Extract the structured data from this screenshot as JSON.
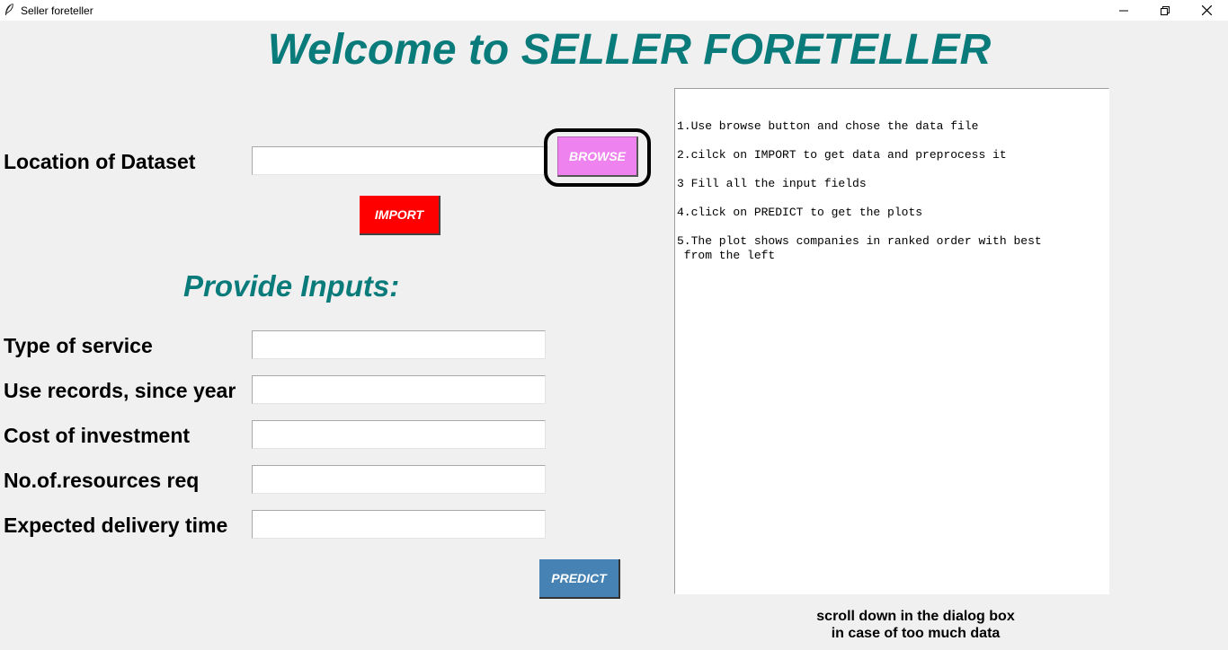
{
  "window": {
    "title": "Seller foreteller",
    "icon": "feather-icon",
    "controls": [
      "minimize-icon",
      "maximize-icon",
      "close-icon"
    ]
  },
  "header": {
    "title": "Welcome to SELLER FORETELLER"
  },
  "dataset": {
    "label": "Location of Dataset",
    "value": "",
    "browse_label": "BROWSE",
    "import_label": "IMPORT"
  },
  "inputs": {
    "section_title": "Provide Inputs:",
    "fields": [
      {
        "label": "Type of service",
        "value": ""
      },
      {
        "label": "Use records, since year",
        "value": ""
      },
      {
        "label": "Cost of investment",
        "value": ""
      },
      {
        "label": "No.of.resources req",
        "value": ""
      },
      {
        "label": "Expected delivery time",
        "value": ""
      }
    ],
    "predict_label": "PREDICT"
  },
  "instructions": {
    "lines": [
      "1.Use browse button and chose the data file",
      "2.cilck on IMPORT to get data and preprocess it",
      "3 Fill all the input fields",
      "4.click on PREDICT to get the plots",
      "5.The plot shows companies in ranked order with best\n from the left"
    ]
  },
  "footer": {
    "line1": "scroll down in the dialog box",
    "line2": "in case of too much data"
  },
  "colors": {
    "title": "#0a7b7b",
    "browse": "#ee82ee",
    "import": "#ff0000",
    "predict": "#4682b4",
    "background": "#f0f0f0"
  }
}
